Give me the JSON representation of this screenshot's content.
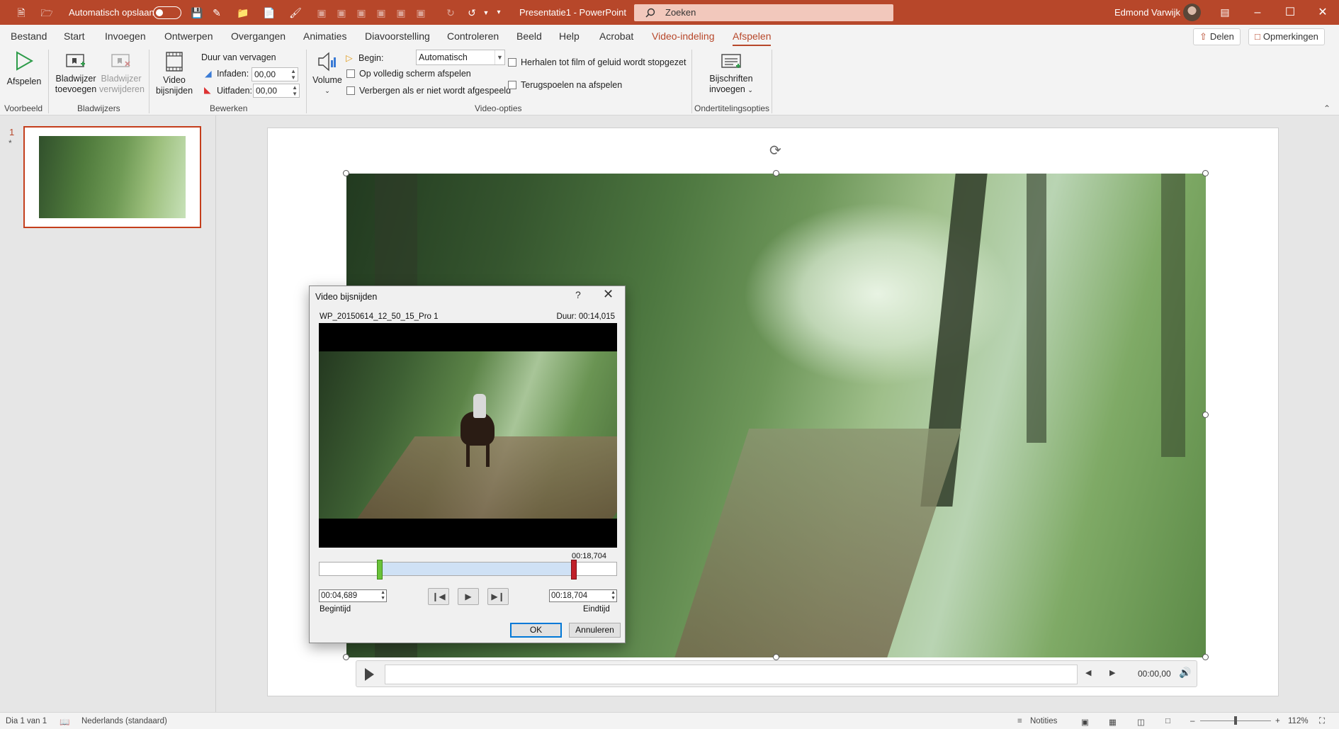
{
  "app": {
    "autosave_label": "Automatisch opslaan",
    "doc_title": "Presentatie1  -  PowerPoint",
    "search_placeholder": "Zoeken",
    "user_name": "Edmond Varwijk",
    "accent_color": "#b7472a"
  },
  "menu": {
    "tabs": [
      "Bestand",
      "Start",
      "Invoegen",
      "Ontwerpen",
      "Overgangen",
      "Animaties",
      "Diavoorstelling",
      "Controleren",
      "Beeld",
      "Help",
      "Acrobat",
      "Video-indeling",
      "Afspelen"
    ],
    "share_label": "Delen",
    "comments_label": "Opmerkingen"
  },
  "ribbon": {
    "play_label": "Afspelen",
    "preview_group": "Voorbeeld",
    "add_bookmark_1": "Bladwijzer",
    "add_bookmark_2": "toevoegen",
    "remove_bookmark_1": "Bladwijzer",
    "remove_bookmark_2": "verwijderen",
    "bookmarks_group": "Bladwijzers",
    "trim_video_1": "Video",
    "trim_video_2": "bijsnijden",
    "fade_duration": "Duur van vervagen",
    "fade_in_label": "Infaden:",
    "fade_in_value": "00,00",
    "fade_out_label": "Uitfaden:",
    "fade_out_value": "00,00",
    "edit_group": "Bewerken",
    "volume_label": "Volume",
    "start_label": "Begin:",
    "start_value": "Automatisch",
    "fullscreen_label": "Op volledig scherm afspelen",
    "hide_label": "Verbergen als er niet wordt afgespeeld",
    "loop_label": "Herhalen tot film of geluid wordt stopgezet",
    "rewind_label": "Terugspoelen na afspelen",
    "video_options_group": "Video-opties",
    "captions_1": "Bijschriften",
    "captions_2": "invoegen",
    "captions_group": "Ondertitelingsopties"
  },
  "thumbnails": {
    "slide_number": "1",
    "slide_marker": "*"
  },
  "player": {
    "time": "00:00,00"
  },
  "dialog": {
    "title": "Video bijsnijden",
    "help": "?",
    "filename": "WP_20150614_12_50_15_Pro 1",
    "duration": "Duur: 00:14,015",
    "end_marker_time": "00:18,704",
    "start_time_value": "00:04,689",
    "start_time_label": "Begintijd",
    "end_time_value": "00:18,704",
    "end_time_label": "Eindtijd",
    "ok_label": "OK",
    "cancel_label": "Annuleren"
  },
  "status": {
    "slide_info": "Dia 1 van 1",
    "language": "Nederlands (standaard)",
    "notes_label": "Notities",
    "zoom": "112%"
  }
}
